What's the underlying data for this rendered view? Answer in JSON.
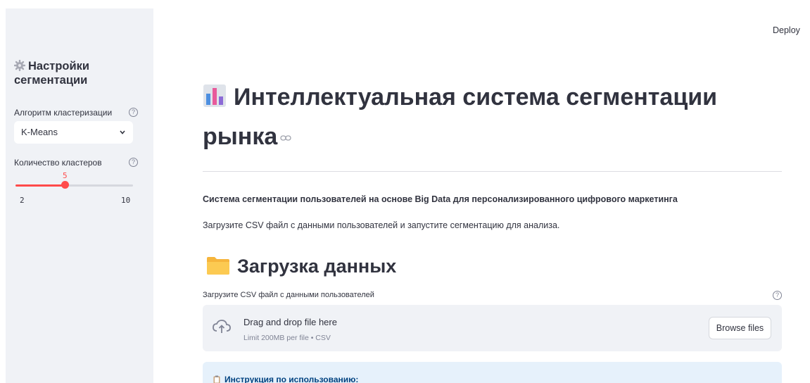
{
  "header": {
    "deploy_label": "Deploy",
    "menu_icon": "more-vertical-icon"
  },
  "sidebar": {
    "title": "Настройки сегментации",
    "title_icon": "gear-icon",
    "algorithm": {
      "label": "Алгоритм кластеризации",
      "selected": "K-Means"
    },
    "clusters": {
      "label": "Количество кластеров",
      "value": "5",
      "min": "2",
      "max": "10"
    }
  },
  "main": {
    "title": "Интеллектуальная система сегментации рынка",
    "title_icon": "bar-chart-icon",
    "subtitle": "Система сегментации пользователей на основе Big Data для персонализированного цифрового маркетинга",
    "description": "Загрузите CSV файл с данными пользователей и запустите сегментацию для анализа.",
    "upload_section": {
      "heading": "Загрузка данных",
      "heading_icon": "folder-icon",
      "uploader_label": "Загрузите CSV файл с данными пользователей",
      "drop_title": "Drag and drop file here",
      "drop_limit": "Limit 200MB per file • CSV",
      "browse_label": "Browse files"
    },
    "info_box": {
      "text": "Инструкция по использованию:",
      "icon": "clipboard-icon"
    }
  },
  "colors": {
    "accent": "#ff4b4b",
    "sidebar_bg": "#f0f2f6",
    "info_bg": "#e6f1fb",
    "info_text": "#004280"
  }
}
